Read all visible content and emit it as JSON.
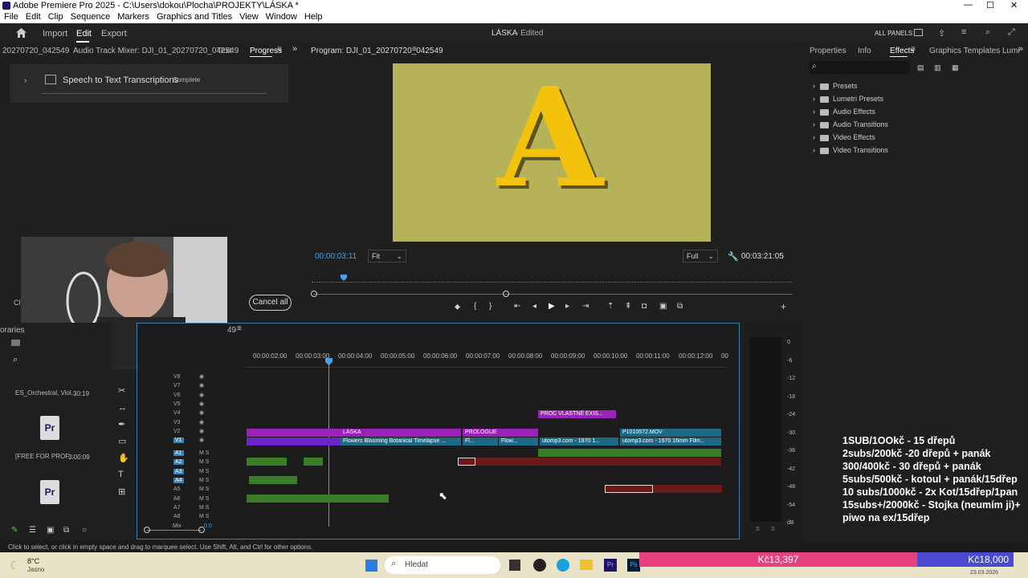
{
  "window": {
    "title": "Adobe Premiere Pro 2025 - C:\\Users\\dokou\\Plocha\\PROJEKTY\\LÁSKA *"
  },
  "menu": [
    "File",
    "Edit",
    "Clip",
    "Sequence",
    "Markers",
    "Graphics and Titles",
    "View",
    "Window",
    "Help"
  ],
  "header": {
    "nav": [
      "Import",
      "Edit",
      "Export"
    ],
    "project_title": "LÁSKA",
    "project_status": "- Edited",
    "all_panels": "ALL PANELS"
  },
  "left_panel": {
    "tabs": [
      "20270720_042549",
      "Audio Track Mixer: DJI_01_20270720_042549",
      "Text",
      "Progress"
    ],
    "job_name": "Speech to Text Transcriptions",
    "job_status": "Complete",
    "cancel_all": "Cancel all",
    "clear_label": "Cl"
  },
  "program_monitor": {
    "title": "Program: DJI_01_20270720_042549",
    "frame_letter": "A",
    "timecode": "00:00:03:11",
    "fit": "Fit",
    "quality": "Full",
    "duration": "00:03:21:05"
  },
  "effects_panel": {
    "tabs": [
      "Properties",
      "Info",
      "Effects",
      "Graphics Templates",
      "Lumi"
    ],
    "items": [
      "Presets",
      "Lumetri Presets",
      "Audio Effects",
      "Audio Transitions",
      "Video Effects",
      "Video Transitions"
    ]
  },
  "project_panel": {
    "label": "oraries",
    "items": [
      {
        "name": "ES_Orchestral, Viol...",
        "duration": "30:19"
      },
      {
        "name": "[FREE FOR PROF...",
        "duration": "3:00:09"
      }
    ]
  },
  "timeline": {
    "sequence_label": "49",
    "ruler": [
      "00:00:02:00",
      "00:00:03:00",
      "00:00:04:00",
      "00:00:05:00",
      "00:00:06:00",
      "00:00:07:00",
      "00:00:08:00",
      "00:00:09:00",
      "00:00:10:00",
      "00:00:11:00",
      "00:00:12:00",
      "00"
    ],
    "video_tracks": [
      "V8",
      "V7",
      "V6",
      "V5",
      "V4",
      "V3",
      "V2",
      "V1"
    ],
    "audio_tracks": [
      "A1",
      "A2",
      "A3",
      "A4",
      "A5",
      "A6",
      "A7",
      "A8"
    ],
    "mix_label": "Mix",
    "mix_value": "0.0",
    "clips": {
      "v4_title": "PROČ VLASTNĚ EXIS...",
      "v2_laska": "LÁSKA",
      "v2_prologue": "PROLOGUE",
      "v2_p101": "P1010572.MOV",
      "v1_flowers": "Flowers Blooming  Botanical Timelapse ...",
      "v1_fl": "Fl...",
      "v1_flow": "Flow...",
      "v1_utomp3a": "utomp3.com - 1970 1...",
      "v1_utomp3b": "utomp3.com - 1970 16mm Film..."
    },
    "fx": "fx"
  },
  "meter": {
    "labels": [
      "0",
      "-6",
      "-12",
      "-18",
      "-24",
      "-30",
      "-36",
      "-42",
      "-48",
      "-54",
      "dB"
    ],
    "solo": [
      "S",
      "S"
    ]
  },
  "status_text": "Click to select, or click in empty space and drag to marquee select. Use Shift, Alt, and Ctrl for other options.",
  "overlay": {
    "lines": [
      "1SUB/1OOkč - 15 dřepů",
      "2subs/200kč -20 dřepů + panák",
      "300/400kč - 30 dřepů + panák",
      "5subs/500kč - kotoul + panák/15dřep",
      "10 subs/1000kč - 2x Kot/15dřep/1pan",
      "15subs+/2000kč - Stojka (neumím ji)+ piwo na ex/15dřep"
    ]
  },
  "donation_goal": {
    "current": "Kč13,397",
    "target": "Kč18,000",
    "progress": 0.744
  },
  "taskbar": {
    "weather_temp": "8°C",
    "weather_desc": "Jasno",
    "search_placeholder": "Hledat",
    "date": "23.03.2026"
  },
  "colors": {
    "accent_blue": "#4a9fe6",
    "title_clip_purple": "#9b22b8",
    "video_clip_blue": "#1c6a86",
    "audio_clip_green": "#3a7d28",
    "audio_clip_red": "#6b1a1a",
    "monitor_bg": "#b6b257",
    "letter_yellow": "#f4c20d"
  }
}
